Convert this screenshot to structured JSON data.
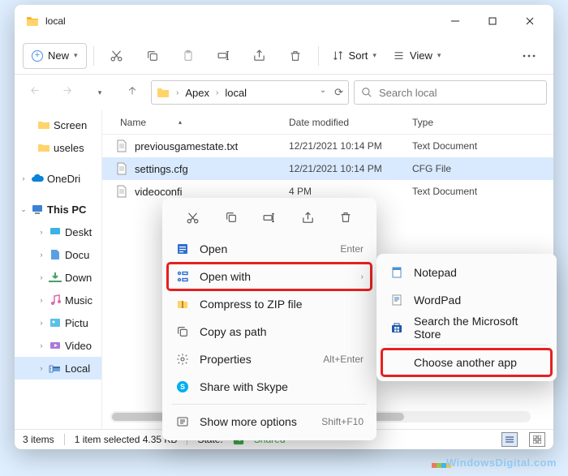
{
  "title": "local",
  "toolbar": {
    "new_label": "New",
    "sort_label": "Sort",
    "view_label": "View"
  },
  "breadcrumb": {
    "seg1": "Apex",
    "seg2": "local"
  },
  "search": {
    "placeholder": "Search local"
  },
  "columns": {
    "name": "Name",
    "date": "Date modified",
    "type": "Type"
  },
  "sidebar": {
    "screen": "Screen",
    "useless": "useles",
    "onedrive": "OneDri",
    "thispc": "This PC",
    "desktop": "Deskt",
    "documents": "Docu",
    "downloads": "Down",
    "music": "Music",
    "pictures": "Pictu",
    "videos": "Video",
    "local": "Local"
  },
  "files": [
    {
      "name": "previousgamestate.txt",
      "date": "12/21/2021 10:14 PM",
      "type": "Text Document",
      "selected": false
    },
    {
      "name": "settings.cfg",
      "date": "12/21/2021 10:14 PM",
      "type": "CFG File",
      "selected": true
    },
    {
      "name": "videoconfi",
      "date": "4 PM",
      "type": "Text Document",
      "selected": false
    }
  ],
  "status": {
    "items": "3 items",
    "selected": "1 item selected  4.35 KB",
    "state_label": "State:",
    "state_value": "Shared"
  },
  "ctx": {
    "open": "Open",
    "open_accel": "Enter",
    "openwith": "Open with",
    "zip": "Compress to ZIP file",
    "copypath": "Copy as path",
    "properties": "Properties",
    "properties_accel": "Alt+Enter",
    "skype": "Share with Skype",
    "more": "Show more options",
    "more_accel": "Shift+F10"
  },
  "sub": {
    "notepad": "Notepad",
    "wordpad": "WordPad",
    "store": "Search the Microsoft Store",
    "choose": "Choose another app"
  },
  "watermark": "WindowsDigital.com"
}
